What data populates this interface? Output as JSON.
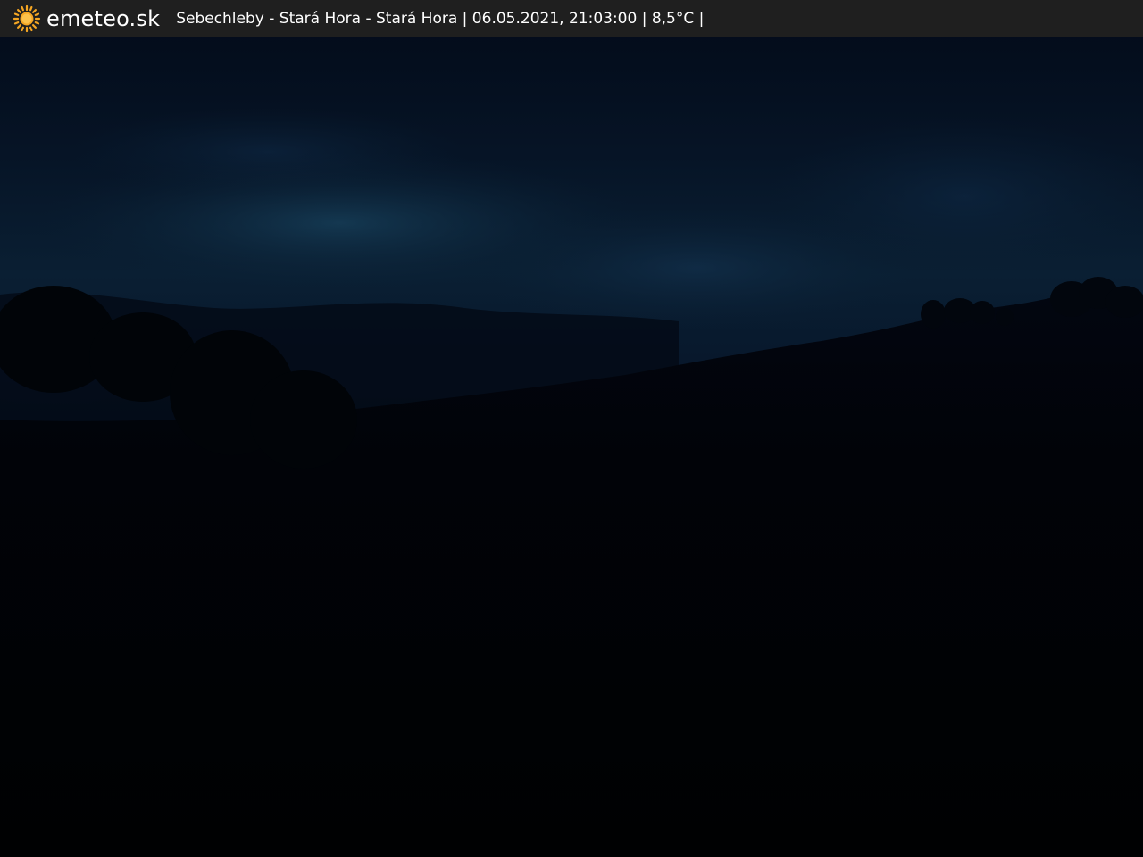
{
  "header": {
    "logo_icon": "sun-icon",
    "brand": "emeteo.sk",
    "caption": "Sebechleby - Stará Hora - Stará Hora | 06.05.2021, 21:03:00 | 8,5°C |"
  },
  "colors": {
    "bar_background": "#1f1f1f",
    "sun": "#f5a623",
    "text": "#ffffff",
    "sky_top": "#040c1a",
    "sky_glow": "#0e2a42",
    "ground": "#010205"
  }
}
